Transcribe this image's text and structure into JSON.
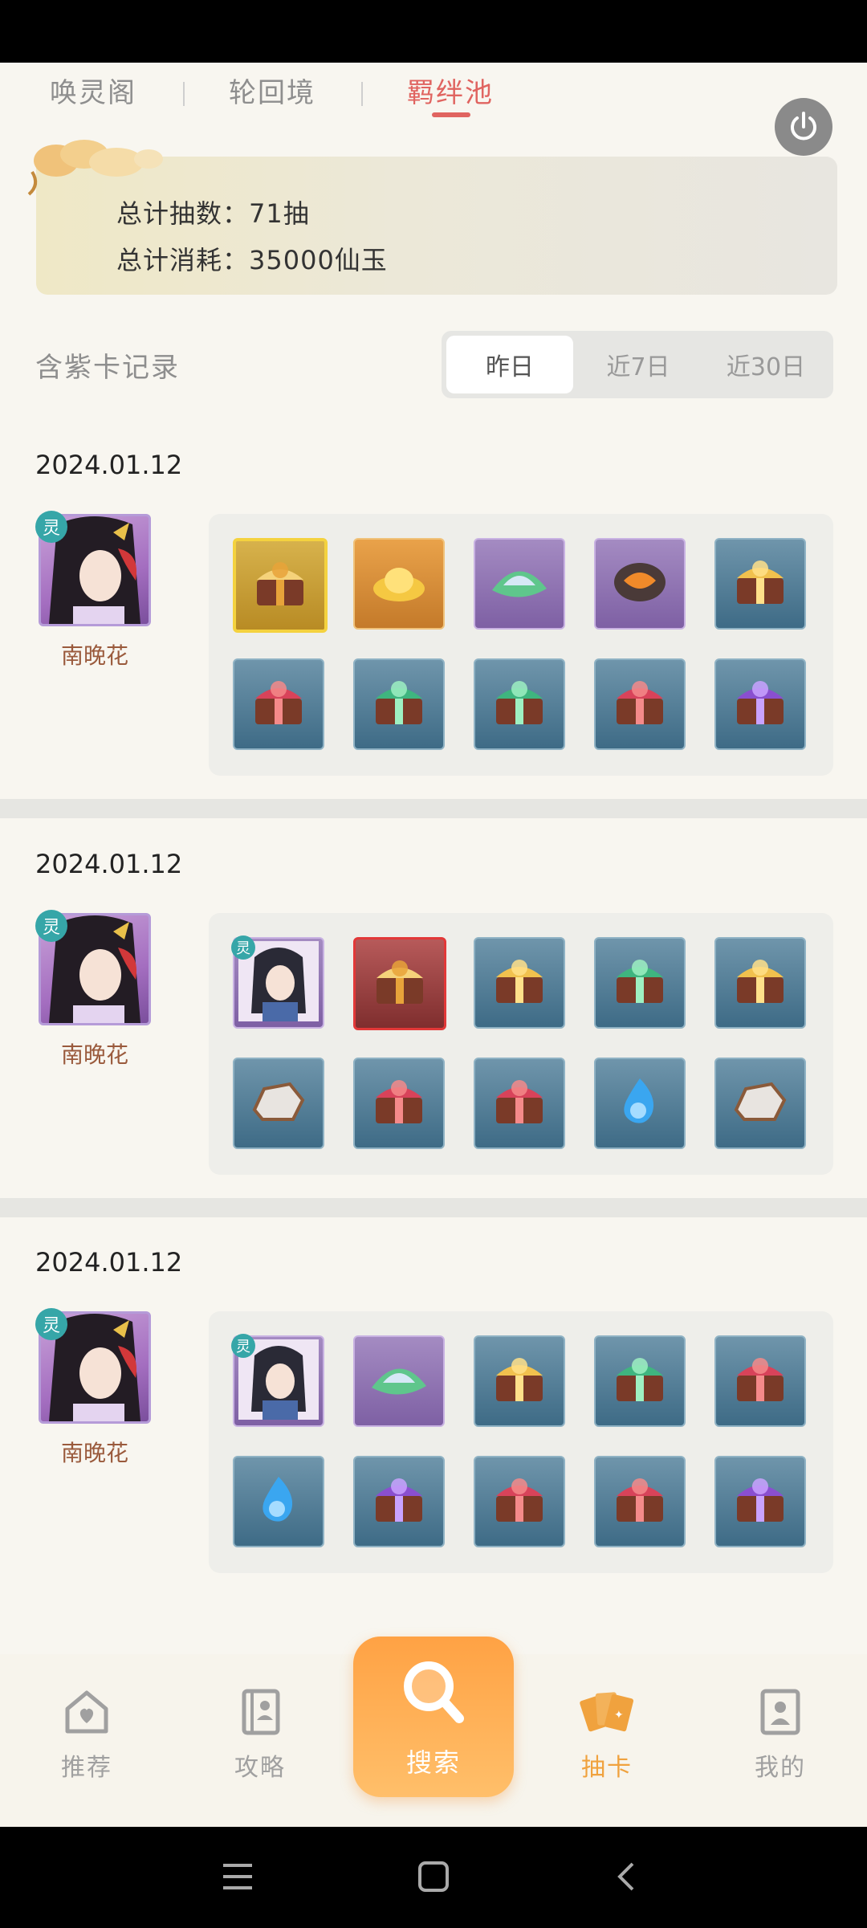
{
  "top_tabs": [
    "唤灵阁",
    "轮回境",
    "羁绊池"
  ],
  "summary": {
    "total_draws": "总计抽数：71抽",
    "total_cost": "总计消耗：35000仙玉"
  },
  "records": {
    "title": "含紫卡记录",
    "filters": [
      "昨日",
      "近7日",
      "近30日"
    ],
    "active_filter": "昨日"
  },
  "sections": [
    {
      "date": "2024.01.12",
      "character": {
        "name": "南晚花",
        "badge": "灵"
      },
      "items": [
        {
          "frame": "gold",
          "icon": "golden-chest-icon"
        },
        {
          "frame": "orange",
          "icon": "gold-ingot-icon"
        },
        {
          "frame": "purple",
          "icon": "jade-leaf-icon"
        },
        {
          "frame": "purple",
          "icon": "orange-stone-icon"
        },
        {
          "frame": "blue",
          "icon": "gold-chest-icon"
        },
        {
          "frame": "blue",
          "icon": "red-chest-icon"
        },
        {
          "frame": "blue",
          "icon": "green-chest-icon"
        },
        {
          "frame": "blue",
          "icon": "green-chest-icon"
        },
        {
          "frame": "blue",
          "icon": "red-chest-icon"
        },
        {
          "frame": "blue",
          "icon": "purple-chest-icon"
        }
      ]
    },
    {
      "date": "2024.01.12",
      "character": {
        "name": "南晚花",
        "badge": "灵"
      },
      "items": [
        {
          "frame": "purple",
          "icon": "character-portrait-icon",
          "badge": "灵"
        },
        {
          "frame": "red",
          "icon": "golden-chest-icon"
        },
        {
          "frame": "blue",
          "icon": "gold-chest-icon"
        },
        {
          "frame": "blue",
          "icon": "green-chest-icon"
        },
        {
          "frame": "blue",
          "icon": "gold-chest-icon"
        },
        {
          "frame": "blue",
          "icon": "ore-stone-icon"
        },
        {
          "frame": "blue",
          "icon": "red-chest-icon"
        },
        {
          "frame": "blue",
          "icon": "red-chest-icon"
        },
        {
          "frame": "blue",
          "icon": "blue-flame-icon"
        },
        {
          "frame": "blue",
          "icon": "ore-stone-icon"
        }
      ]
    },
    {
      "date": "2024.01.12",
      "character": {
        "name": "南晚花",
        "badge": "灵"
      },
      "items": [
        {
          "frame": "purple",
          "icon": "character-portrait-icon",
          "badge": "灵"
        },
        {
          "frame": "purple",
          "icon": "jade-leaf-icon"
        },
        {
          "frame": "blue",
          "icon": "gold-chest-icon"
        },
        {
          "frame": "blue",
          "icon": "green-chest-icon"
        },
        {
          "frame": "blue",
          "icon": "red-chest-icon"
        },
        {
          "frame": "blue",
          "icon": "blue-flame-icon"
        },
        {
          "frame": "blue",
          "icon": "purple-chest-icon"
        },
        {
          "frame": "blue",
          "icon": "red-chest-icon"
        },
        {
          "frame": "blue",
          "icon": "red-chest-icon"
        },
        {
          "frame": "blue",
          "icon": "purple-chest-icon"
        }
      ]
    }
  ],
  "bottom_nav": [
    {
      "label": "推荐",
      "icon": "heart-house-icon"
    },
    {
      "label": "攻略",
      "icon": "book-icon"
    },
    {
      "label": "搜索",
      "icon": "search-icon"
    },
    {
      "label": "抽卡",
      "icon": "cards-icon"
    },
    {
      "label": "我的",
      "icon": "profile-icon"
    }
  ],
  "colors": {
    "accent": "#e06460",
    "nav_active": "#f0a23e",
    "search_button": "#ffa244"
  }
}
